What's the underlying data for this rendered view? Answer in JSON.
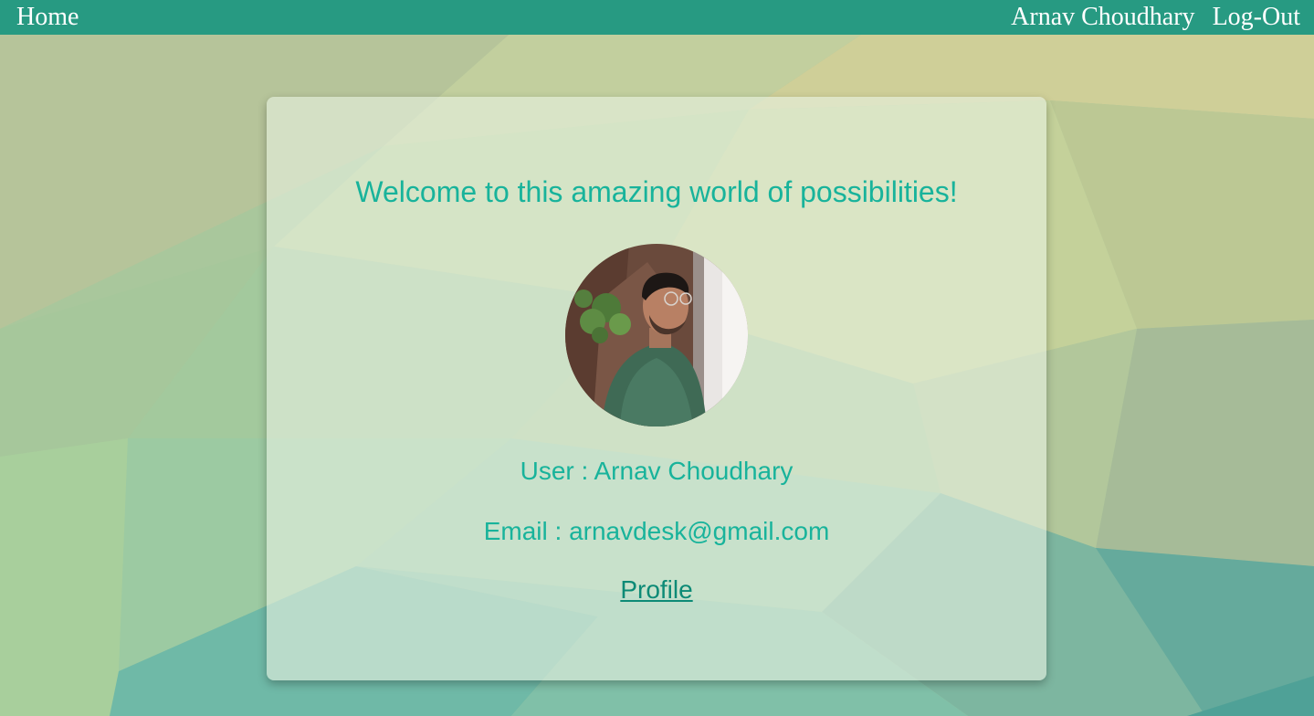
{
  "navbar": {
    "home_label": "Home",
    "user_name": "Arnav Choudhary",
    "logout_label": "Log-Out"
  },
  "card": {
    "welcome_text": "Welcome to this amazing world of possibilities!",
    "user_line": "User : Arnav Choudhary",
    "email_line": "Email : arnavdesk@gmail.com",
    "profile_link": "Profile"
  },
  "colors": {
    "navbar_bg": "#279a82",
    "accent_text": "#18b39b",
    "link_text": "#0c8a76"
  }
}
